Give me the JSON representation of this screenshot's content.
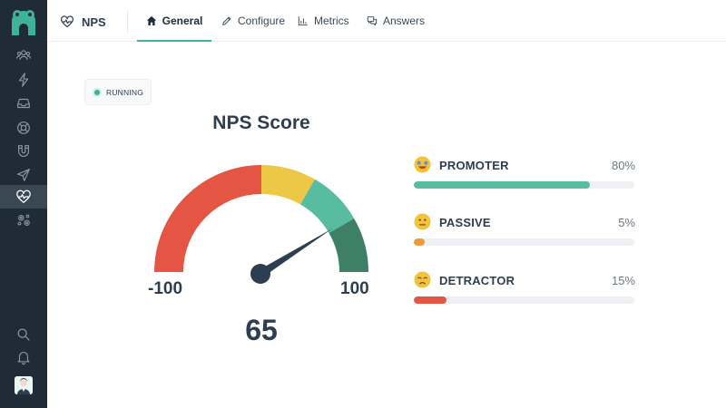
{
  "colors": {
    "sidebar_bg": "#1f2b36",
    "accent": "#3eb399",
    "gauge_red": "#e45643",
    "gauge_yellow": "#edc846",
    "gauge_light_green": "#57bca0",
    "gauge_dark_green": "#3e8066",
    "needle": "#2d3e50",
    "promoter": "#57bca0",
    "passive": "#ef9a3a",
    "detractor": "#e45643"
  },
  "sidebar": {
    "logo_icon": "frog-logo-icon",
    "items": [
      {
        "icon": "users-icon"
      },
      {
        "icon": "lightning-icon"
      },
      {
        "icon": "inbox-icon"
      },
      {
        "icon": "lifebuoy-icon"
      },
      {
        "icon": "magnet-icon"
      },
      {
        "icon": "send-icon"
      },
      {
        "icon": "heart-pulse-icon",
        "active": true
      },
      {
        "icon": "integrations-icon"
      }
    ],
    "bottom_items": [
      {
        "icon": "search-icon"
      },
      {
        "icon": "bell-icon"
      }
    ],
    "avatar": "user-avatar"
  },
  "header": {
    "app_label": "NPS",
    "app_icon": "heart-pulse-icon",
    "tabs": [
      {
        "label": "General",
        "icon": "home-icon",
        "active": true
      },
      {
        "label": "Configure",
        "icon": "pencil-icon"
      },
      {
        "label": "Metrics",
        "icon": "bar-chart-icon"
      },
      {
        "label": "Answers",
        "icon": "chat-bubbles-icon"
      }
    ]
  },
  "status": {
    "label": "RUNNING"
  },
  "gauge": {
    "title": "NPS Score",
    "min_label": "-100",
    "max_label": "100",
    "min": -100,
    "max": 100,
    "value": 65,
    "value_label": "65"
  },
  "breakdown": [
    {
      "label": "PROMOTER",
      "percent": 80,
      "percent_label": "80%",
      "emoji": "star-eyes-emoji"
    },
    {
      "label": "PASSIVE",
      "percent": 5,
      "percent_label": "5%",
      "emoji": "neutral-face-emoji"
    },
    {
      "label": "DETRACTOR",
      "percent": 15,
      "percent_label": "15%",
      "emoji": "sad-face-emoji"
    }
  ]
}
